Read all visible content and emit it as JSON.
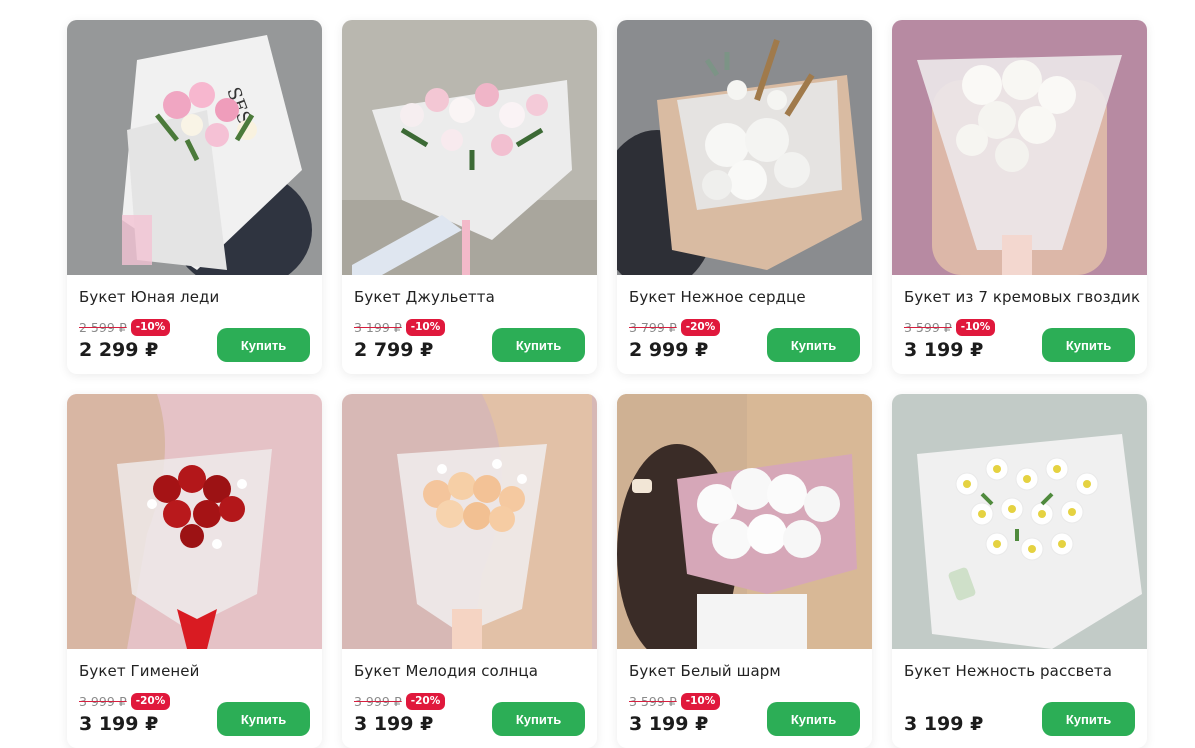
{
  "colors": {
    "accent_green": "#2cae56",
    "discount_red": "#e0183c",
    "text_dark": "#1c1c1c",
    "old_price_gray": "#8a8a8a"
  },
  "products": [
    {
      "title": "Букет Юная леди",
      "old_price": "2 599 ₽",
      "discount": "-10%",
      "price": "2 299 ₽",
      "buy_label": "Купить"
    },
    {
      "title": "Букет Джульетта",
      "old_price": "3 199 ₽",
      "discount": "-10%",
      "price": "2 799 ₽",
      "buy_label": "Купить"
    },
    {
      "title": "Букет Нежное сердце",
      "old_price": "3 799 ₽",
      "discount": "-20%",
      "price": "2 999 ₽",
      "buy_label": "Купить"
    },
    {
      "title": "Букет из 7 кремовых гвоздик",
      "old_price": "3 599 ₽",
      "discount": "-10%",
      "price": "3 199 ₽",
      "buy_label": "Купить"
    },
    {
      "title": "Букет Гименей",
      "old_price": "3 999 ₽",
      "discount": "-20%",
      "price": "3 199 ₽",
      "buy_label": "Купить"
    },
    {
      "title": "Букет Мелодия солнца",
      "old_price": "3 999 ₽",
      "discount": "-20%",
      "price": "3 199 ₽",
      "buy_label": "Купить"
    },
    {
      "title": "Букет Белый шарм",
      "old_price": "3 599 ₽",
      "discount": "-10%",
      "price": "3 199 ₽",
      "buy_label": "Купить"
    },
    {
      "title": "Букет Нежность рассвета",
      "price": "3 199 ₽",
      "buy_label": "Купить"
    }
  ]
}
